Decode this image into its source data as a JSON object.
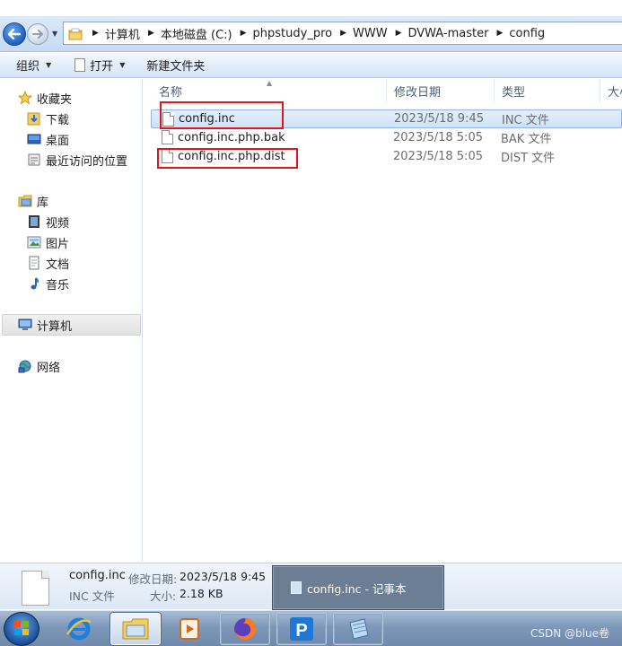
{
  "address_bar": {
    "breadcrumbs": [
      "计算机",
      "本地磁盘 (C:)",
      "phpstudy_pro",
      "WWW",
      "DVWA-master",
      "config"
    ]
  },
  "toolbar": {
    "organize_label": "组织",
    "open_label": "打开",
    "new_folder_label": "新建文件夹"
  },
  "nav_pane": {
    "favorites_label": "收藏夹",
    "favorites": [
      "下载",
      "桌面",
      "最近访问的位置"
    ],
    "libraries_label": "库",
    "libraries": [
      "视频",
      "图片",
      "文档",
      "音乐"
    ],
    "computer_label": "计算机",
    "network_label": "网络"
  },
  "columns": {
    "name": "名称",
    "date": "修改日期",
    "type": "类型",
    "size": "大小"
  },
  "files": [
    {
      "name": "config.inc",
      "date": "2023/5/18 9:45",
      "type": "INC 文件",
      "selected": true,
      "highlighted": true
    },
    {
      "name": "config.inc.php.bak",
      "date": "2023/5/18 5:05",
      "type": "BAK 文件",
      "selected": false,
      "highlighted": false
    },
    {
      "name": "config.inc.php.dist",
      "date": "2023/5/18 5:05",
      "type": "DIST 文件",
      "selected": false,
      "highlighted": true
    }
  ],
  "details": {
    "filename": "config.inc",
    "modified_label": "修改日期:",
    "modified_value": "2023/5/18 9:45",
    "type": "INC 文件",
    "size_label": "大小:",
    "size_value": "2.18 KB"
  },
  "taskbar": {
    "notepad_preview": "config.inc - 记事本",
    "watermark": "CSDN @blue卷"
  },
  "colors": {
    "highlight_box": "#e5141a",
    "selection": "#cfe1f7",
    "taskbar": "#7f98b9"
  }
}
